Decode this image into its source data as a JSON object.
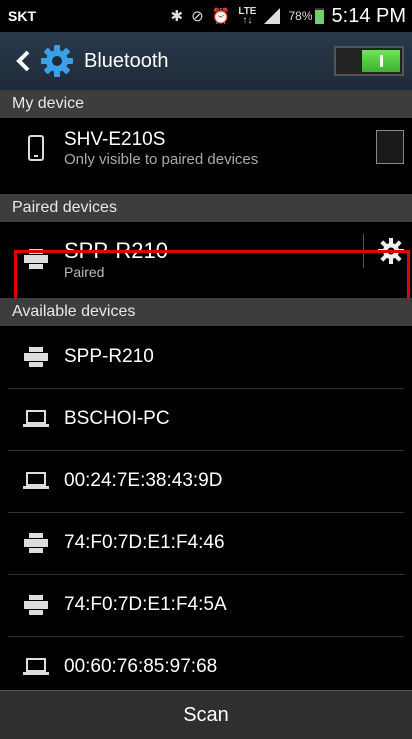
{
  "status": {
    "carrier": "SKT",
    "lte": [
      "LTE",
      "↑↓"
    ],
    "battery": "78%",
    "time": "5:14 PM"
  },
  "actionbar": {
    "title": "Bluetooth",
    "toggle_on": true
  },
  "sections": {
    "my_device": "My device",
    "paired": "Paired devices",
    "available": "Available devices"
  },
  "my_device": {
    "name": "SHV-E210S",
    "subtitle": "Only visible to paired devices",
    "icon": "phone-icon"
  },
  "paired_device": {
    "name": "SPP-R210",
    "status": "Paired",
    "icon": "printer-icon"
  },
  "available_devices": [
    {
      "name": "SPP-R210",
      "icon": "printer-icon"
    },
    {
      "name": "BSCHOI-PC",
      "icon": "laptop-icon"
    },
    {
      "name": "00:24:7E:38:43:9D",
      "icon": "laptop-icon"
    },
    {
      "name": "74:F0:7D:E1:F4:46",
      "icon": "printer-icon"
    },
    {
      "name": "74:F0:7D:E1:F4:5A",
      "icon": "printer-icon"
    },
    {
      "name": "00:60:76:85:97:68",
      "icon": "laptop-icon"
    }
  ],
  "scan_label": "Scan",
  "colors": {
    "highlight": "#e40000",
    "toggle": "#4fcf3a",
    "section_bg": "#3d3d3d",
    "actionbar_bg": "#24303f"
  }
}
